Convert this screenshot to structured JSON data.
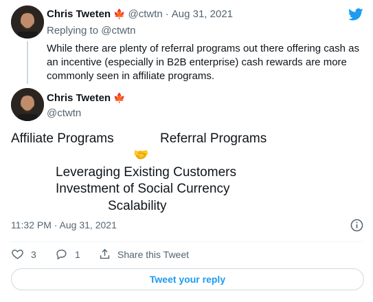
{
  "tweet1": {
    "name": "Chris Tweten",
    "flag": "🍁",
    "handle": "@ctwtn",
    "sep": "·",
    "date": "Aug 31, 2021",
    "replying_prefix": "Replying to",
    "replying_to": "@ctwtn",
    "text": "While there are plenty of referral programs out there offering cash as an incentive (especially in B2B enterprise) cash rewards are more commonly seen in affiliate programs."
  },
  "tweet2": {
    "name": "Chris Tweten",
    "flag": "🍁",
    "handle": "@ctwtn",
    "left_title": "Affiliate Programs",
    "right_title": "Referral Programs",
    "emoji": "🤝",
    "line1": "Leveraging Existing Customers",
    "line2": "Investment of Social Currency",
    "line3": "Scalability",
    "timestamp": "11:32 PM · Aug 31, 2021"
  },
  "actions": {
    "like_count": "3",
    "reply_count": "1",
    "share_label": "Share this Tweet"
  },
  "reply_button": "Tweet your reply",
  "colors": {
    "accent": "#1d9bf0",
    "muted": "#536471"
  }
}
